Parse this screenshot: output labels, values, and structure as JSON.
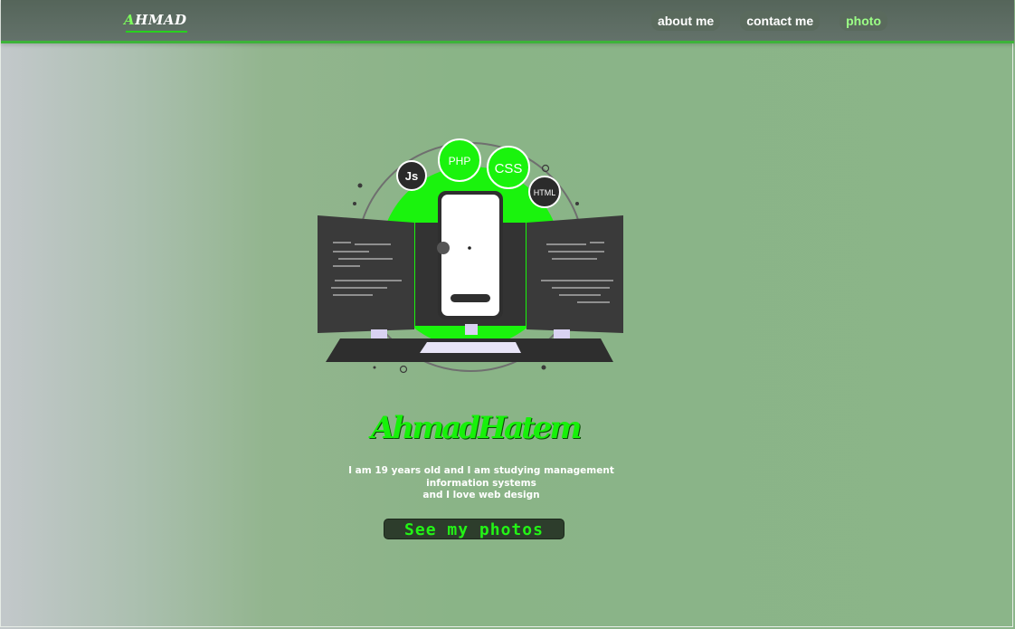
{
  "header": {
    "logo_first_letter": "A",
    "logo_rest": "HMAD",
    "nav": [
      {
        "label": "about me"
      },
      {
        "label": "contact me"
      },
      {
        "label": "photo"
      }
    ]
  },
  "hero": {
    "badges": {
      "js": "Js",
      "php": "PHP",
      "css": "CSS",
      "html": "HTML"
    },
    "signature": "AhmadHatem",
    "bio_lines": [
      "I am 19 years old and I am studying management",
      "information systems",
      "and I love web design"
    ],
    "cta_label": "See my photos"
  },
  "colors": {
    "accent": "#1af30d",
    "nav_bg": "#5b6b60",
    "page_bg": "#8bb589",
    "button_bg": "#2d3d2c"
  },
  "icons": [
    "code-monitor-illustration",
    "phone-icon",
    "keyboard-icon"
  ]
}
